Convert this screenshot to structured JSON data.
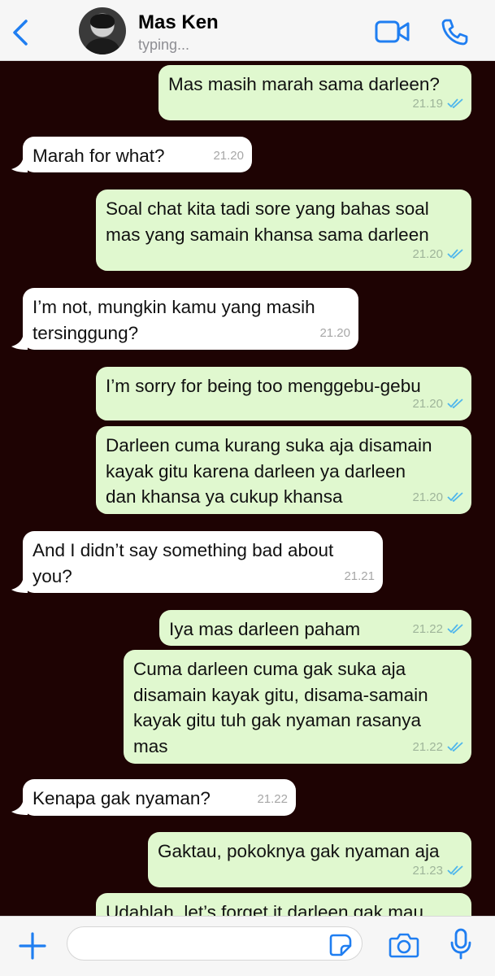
{
  "header": {
    "contact_name": "Mas Ken",
    "status": "typing..."
  },
  "messages": [
    {
      "direction": "out",
      "text": "Mas masih marah sama darleen?",
      "time": "21.19",
      "read": true
    },
    {
      "direction": "in",
      "text": "Marah for what?",
      "time": "21.20"
    },
    {
      "direction": "out",
      "text": "Soal chat kita tadi sore yang bahas soal\nmas yang samain khansa sama darleen",
      "time": "21.20",
      "read": true
    },
    {
      "direction": "in",
      "text": "I’m not, mungkin kamu yang masih\ntersinggung?",
      "time": "21.20"
    },
    {
      "direction": "out",
      "text": "I’m sorry for being too menggebu-gebu",
      "time": "21.20",
      "read": true
    },
    {
      "direction": "out",
      "text": "Darleen cuma kurang suka aja disamain\nkayak gitu karena darleen ya darleen\ndan khansa ya cukup khansa",
      "time": "21.20",
      "read": true
    },
    {
      "direction": "in",
      "text": "And I didn’t say something bad about\nyou?",
      "time": "21.21"
    },
    {
      "direction": "out",
      "text": "Iya mas darleen paham",
      "time": "21.22",
      "read": true
    },
    {
      "direction": "out",
      "text": "Cuma darleen cuma gak suka aja\ndisamain kayak gitu, disama-samain\nkayak gitu tuh gak nyaman rasanya\nmas",
      "time": "21.22",
      "read": true
    },
    {
      "direction": "in",
      "text": "Kenapa gak nyaman?",
      "time": "21.22"
    },
    {
      "direction": "out",
      "text": "Gaktau, pokoknya gak nyaman aja",
      "time": "21.23",
      "read": true
    },
    {
      "direction": "out",
      "text": "Udahlah, let’s forget it darleen gak mau",
      "time": "",
      "read": false
    }
  ],
  "footer": {
    "input_placeholder": ""
  },
  "icons": {
    "back": "chevron-left-icon",
    "video": "video-call-icon",
    "phone": "phone-icon",
    "plus": "plus-icon",
    "sticker": "sticker-icon",
    "camera": "camera-icon",
    "mic": "microphone-icon",
    "read": "double-check-icon"
  },
  "colors": {
    "accent": "#1f7ef1",
    "outgoing_bubble": "#e0f8cf",
    "incoming_bubble": "#ffffff",
    "chat_background": "#1e0303",
    "read_check": "#4fb6ec"
  }
}
